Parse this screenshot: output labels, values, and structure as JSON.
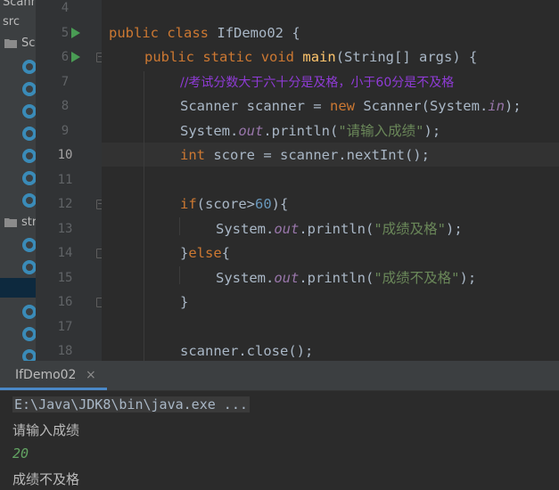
{
  "project": {
    "truncated_top": "Scann",
    "src_label": "src",
    "folder1_label": "Sc",
    "folder2_label": "str"
  },
  "gutter": {
    "line_numbers": [
      "4",
      "5",
      "6",
      "7",
      "8",
      "9",
      "10",
      "11",
      "12",
      "13",
      "14",
      "15",
      "16",
      "17",
      "18"
    ],
    "current_line": "10"
  },
  "code": {
    "line5": {
      "kw1": "public",
      "kw2": "class",
      "name": "IfDemo02",
      "brace": "{"
    },
    "line6": {
      "kw1": "public",
      "kw2": "static",
      "kw3": "void",
      "fn": "main",
      "params": "(String[] args) {"
    },
    "line7": {
      "comment": "//考试分数大于六十分是及格，小于60分是不及格"
    },
    "line8": {
      "p1": "Scanner scanner = ",
      "kw": "new",
      "p2": " Scanner(System.",
      "fld": "in",
      "p3": ");"
    },
    "line9": {
      "p1": "System.",
      "fld": "out",
      "p2": ".println(",
      "str": "\"请输入成绩\"",
      "p3": ");"
    },
    "line10": {
      "kw": "int",
      "p1": " score = scanner.nextInt();"
    },
    "line12": {
      "kw": "if",
      "p1": "(score>",
      "num": "60",
      "p2": "){"
    },
    "line13": {
      "p1": "System.",
      "fld": "out",
      "p2": ".println(",
      "str": "\"成绩及格\"",
      "p3": ");"
    },
    "line14": {
      "p1": "}",
      "kw": "else",
      "p2": "{"
    },
    "line15": {
      "p1": "System.",
      "fld": "out",
      "p2": ".println(",
      "str": "\"成绩不及格\"",
      "p3": ");"
    },
    "line16": {
      "p1": "}"
    },
    "line18": {
      "p1": "scanner.close();"
    }
  },
  "run_panel": {
    "tab_label": "IfDemo02",
    "tab_close": "×",
    "command": "E:\\Java\\JDK8\\bin\\java.exe ...",
    "output_prompt": "请输入成绩",
    "user_input": "20",
    "output_result": "成绩不及格"
  },
  "colors": {
    "keyword": "#cc7832",
    "method": "#ffc66d",
    "string": "#6a8759",
    "number": "#6897bb",
    "field": "#9876aa",
    "comment": "#8f3bd6",
    "input": "#62a362",
    "accent": "#4a88c7"
  },
  "icons": {
    "run_gutter": "run-triangle-icon",
    "fold": "fold-marker-icon",
    "folder": "folder-icon",
    "class": "java-class-icon",
    "tab_close": "close-icon"
  }
}
